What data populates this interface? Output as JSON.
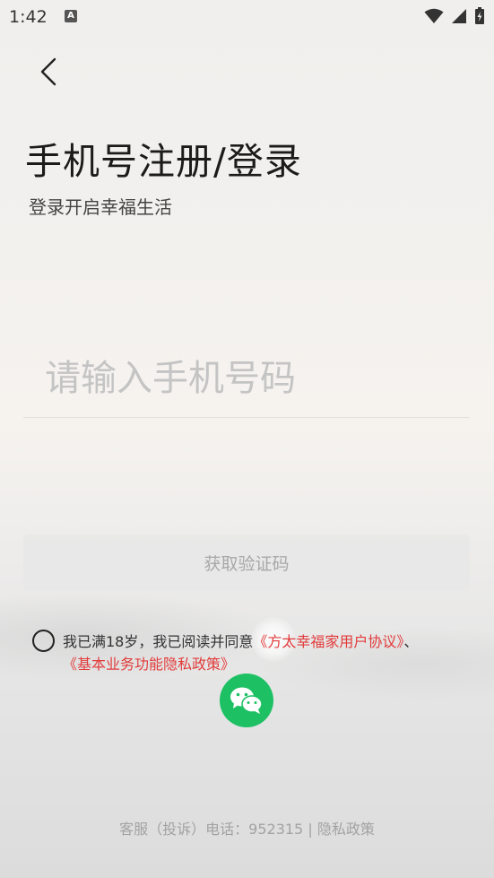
{
  "status_bar": {
    "time": "1:42",
    "notification_icon": "A",
    "icons": [
      "wifi-icon",
      "signal-icon",
      "battery-charging-icon"
    ]
  },
  "header": {
    "back_icon": "chevron-left-icon",
    "title": "手机号注册/登录",
    "subtitle": "登录开启幸福生活"
  },
  "form": {
    "phone_placeholder": "请输入手机号码",
    "phone_value": "",
    "code_button_label": "获取验证码"
  },
  "agreement": {
    "checked": false,
    "prefix": "我已满18岁，我已阅读并同意",
    "user_agreement": "《方太幸福家用户协议》",
    "separator": "、",
    "privacy_policy": "《基本业务功能隐私政策》"
  },
  "social_login": {
    "wechat_icon": "wechat-icon",
    "brand_color": "#1dc164"
  },
  "footer": {
    "service_text": "客服（投诉）电话：952315",
    "divider": "|",
    "privacy_link": "隐私政策"
  },
  "colors": {
    "link": "#e23b3b",
    "placeholder": "#c4c4c4",
    "disabled_button_text": "#a8a8a8"
  }
}
